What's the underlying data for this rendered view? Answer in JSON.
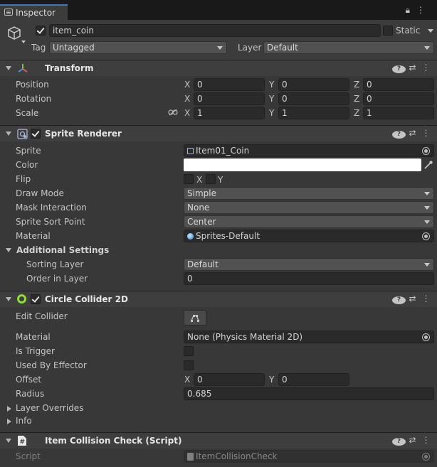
{
  "tab": {
    "title": "Inspector",
    "right_icons": [
      "lock-icon",
      "menu-icon"
    ]
  },
  "gameobject": {
    "name": "item_coin",
    "active": true,
    "static_label": "Static",
    "static": false,
    "tag_label": "Tag",
    "tag": "Untagged",
    "layer_label": "Layer",
    "layer": "Default"
  },
  "transform": {
    "title": "Transform",
    "position_label": "Position",
    "rotation_label": "Rotation",
    "scale_label": "Scale",
    "position": {
      "x": "0",
      "y": "0",
      "z": "0"
    },
    "rotation": {
      "x": "0",
      "y": "0",
      "z": "0"
    },
    "scale": {
      "x": "1",
      "y": "1",
      "z": "1"
    }
  },
  "axes": {
    "x": "X",
    "y": "Y",
    "z": "Z"
  },
  "sprite_renderer": {
    "title": "Sprite Renderer",
    "enabled": true,
    "sprite_label": "Sprite",
    "sprite": "Item01_Coin",
    "color_label": "Color",
    "color_value": "#ffffff",
    "flip_label": "Flip",
    "flip_x": "X",
    "flip_y": "Y",
    "draw_mode_label": "Draw Mode",
    "draw_mode": "Simple",
    "mask_label": "Mask Interaction",
    "mask": "None",
    "sort_point_label": "Sprite Sort Point",
    "sort_point": "Center",
    "material_label": "Material",
    "material": "Sprites-Default",
    "additional_label": "Additional Settings",
    "sorting_layer_label": "Sorting Layer",
    "sorting_layer": "Default",
    "order_label": "Order in Layer",
    "order": "0"
  },
  "circle_collider": {
    "title": "Circle Collider 2D",
    "enabled": true,
    "edit_label": "Edit Collider",
    "material_label": "Material",
    "material": "None (Physics Material 2D)",
    "trigger_label": "Is Trigger",
    "effector_label": "Used By Effector",
    "offset_label": "Offset",
    "offset": {
      "x": "0",
      "y": "0"
    },
    "radius_label": "Radius",
    "radius": "0.685",
    "layer_overrides_label": "Layer Overrides",
    "info_label": "Info"
  },
  "script_component": {
    "title": "Item Collision Check (Script)",
    "script_label": "Script",
    "script": "ItemCollisionCheck"
  },
  "colors": {
    "accent": "#3a79bb",
    "collider_icon": "#8fdc3a"
  }
}
